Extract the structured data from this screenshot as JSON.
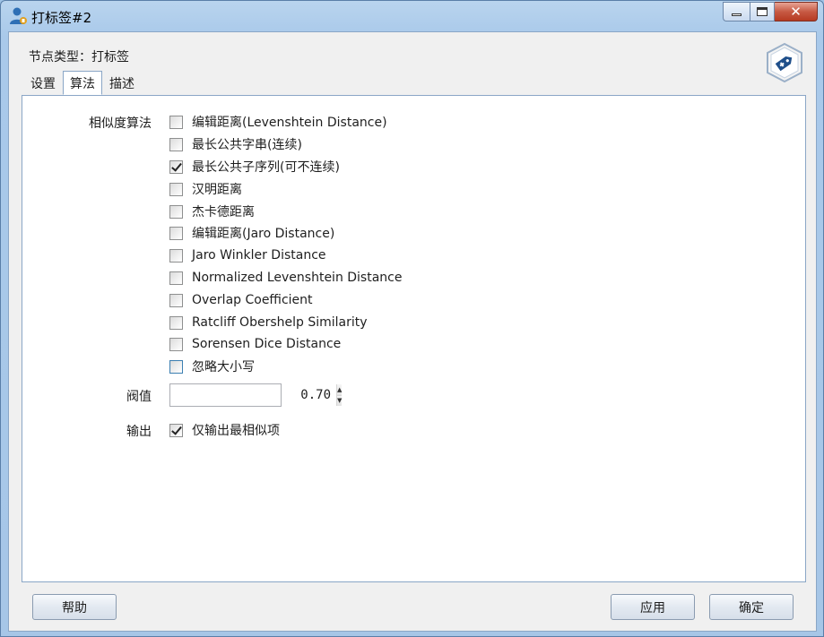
{
  "window": {
    "title": "打标签#2",
    "close_glyph": "✕"
  },
  "header": {
    "node_type": "节点类型：打标签",
    "node_icon": "tag-hexagon-icon"
  },
  "tabs": [
    {
      "label": "设置",
      "active": false
    },
    {
      "label": "算法",
      "active": true
    },
    {
      "label": "描述",
      "active": false
    }
  ],
  "algorithm": {
    "label": "相似度算法",
    "options": [
      {
        "label": "编辑距离(Levenshtein Distance)",
        "checked": false
      },
      {
        "label": "最长公共字串(连续)",
        "checked": false
      },
      {
        "label": "最长公共子序列(可不连续)",
        "checked": true
      },
      {
        "label": "汉明距离",
        "checked": false
      },
      {
        "label": "杰卡德距离",
        "checked": false
      },
      {
        "label": "编辑距离(Jaro Distance)",
        "checked": false
      },
      {
        "label": "Jaro Winkler Distance",
        "checked": false
      },
      {
        "label": "Normalized Levenshtein Distance",
        "checked": false
      },
      {
        "label": "Overlap Coefficient",
        "checked": false
      },
      {
        "label": "Ratcliff Obershelp Similarity",
        "checked": false
      },
      {
        "label": "Sorensen Dice Distance",
        "checked": false
      },
      {
        "label": "忽略大小写",
        "checked": false
      }
    ]
  },
  "threshold": {
    "label": "阀值",
    "value": "0.70",
    "up_glyph": "▲",
    "down_glyph": "▼"
  },
  "output": {
    "label": "输出",
    "option_label": "仅输出最相似项",
    "checked": true
  },
  "footer": {
    "help_label": "帮助",
    "apply_label": "应用",
    "ok_label": "确定"
  },
  "colors": {
    "accent": "#3c7fb1",
    "frame": "#a9c9ea",
    "close": "#c75a44"
  }
}
